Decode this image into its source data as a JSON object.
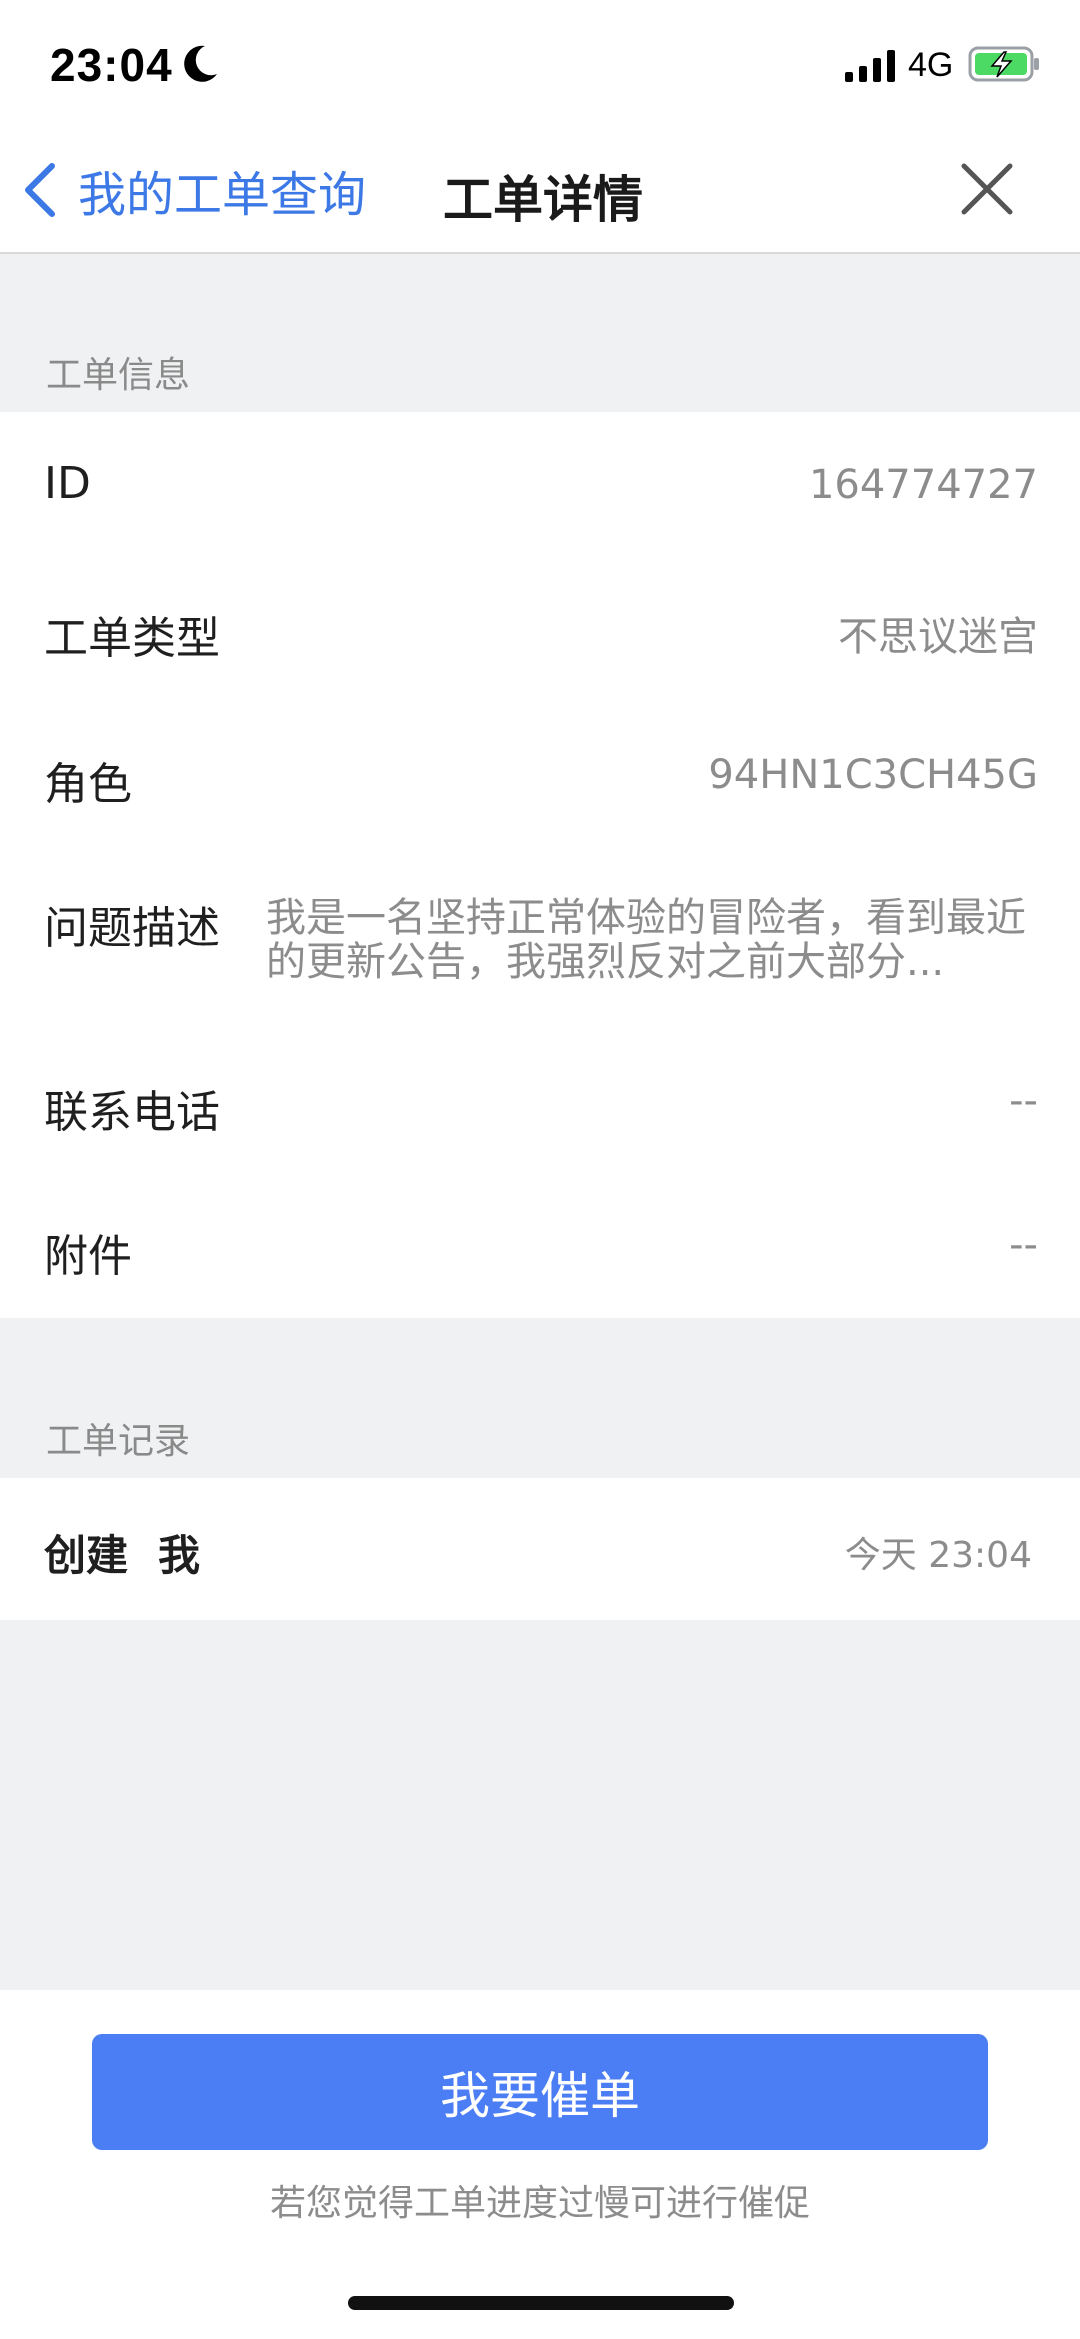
{
  "status_bar": {
    "time": "23:04",
    "network": "4G",
    "icons": [
      "moon-icon",
      "signal-icon",
      "battery-charging-icon"
    ]
  },
  "nav": {
    "back_label": "我的工单查询",
    "title": "工单详情",
    "icons": [
      "chevron-left-icon",
      "close-icon"
    ]
  },
  "ticket_info": {
    "section_title": "工单信息",
    "rows": [
      {
        "label": "ID",
        "value": "164774727"
      },
      {
        "label": "工单类型",
        "value": "不思议迷宫"
      },
      {
        "label": "角色",
        "value": "94HN1C3CH45G"
      },
      {
        "label": "问题描述",
        "value": "我是一名坚持正常体验的冒险者，看到最近的更新公告，我强烈反对之前大部分..."
      },
      {
        "label": "联系电话",
        "value": "--"
      },
      {
        "label": "附件",
        "value": "--"
      }
    ]
  },
  "ticket_record": {
    "section_title": "工单记录",
    "entries": [
      {
        "action": "创建",
        "actor": "我",
        "time": "今天 23:04"
      }
    ]
  },
  "bottom": {
    "urge_button_label": "我要催单",
    "hint": "若您觉得工单进度过慢可进行催促"
  },
  "colors": {
    "accent": "#4b7df4",
    "link": "#3c78e6",
    "background": "#f0f1f3",
    "muted_text": "#8c8c8c"
  }
}
